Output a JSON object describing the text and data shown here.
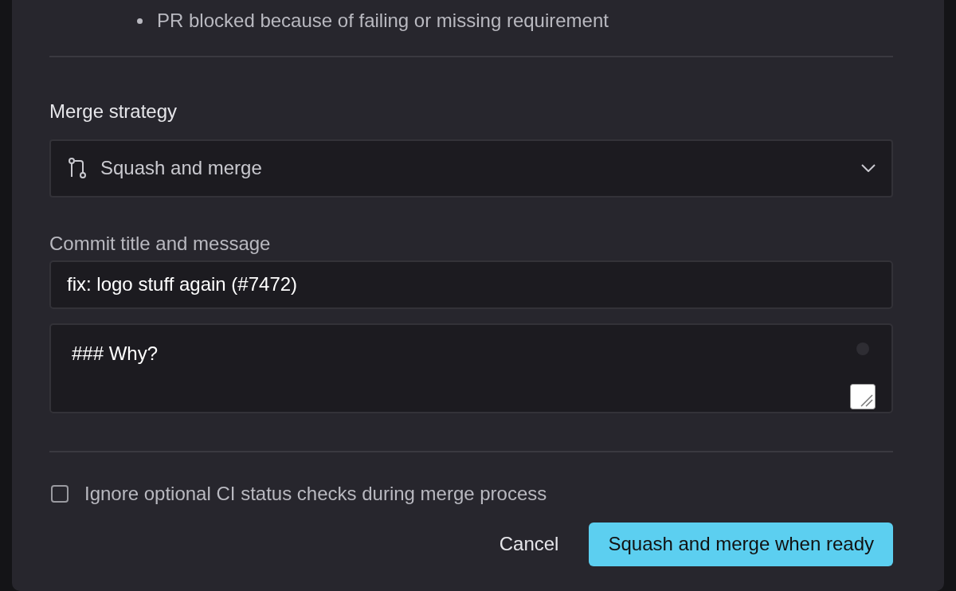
{
  "requirements": [
    "PR blocked because of failing or missing requirement"
  ],
  "merge_strategy": {
    "label": "Merge strategy",
    "value": "Squash and merge"
  },
  "commit": {
    "label": "Commit title and message",
    "title": "fix: logo stuff again (#7472)",
    "message": "### Why?"
  },
  "ignore_optional_checks": {
    "label": "Ignore optional CI status checks during merge process",
    "checked": false
  },
  "buttons": [
    {
      "kind": "secondary",
      "label": "Cancel"
    },
    {
      "kind": "primary",
      "label": "Squash and merge when ready"
    }
  ]
}
